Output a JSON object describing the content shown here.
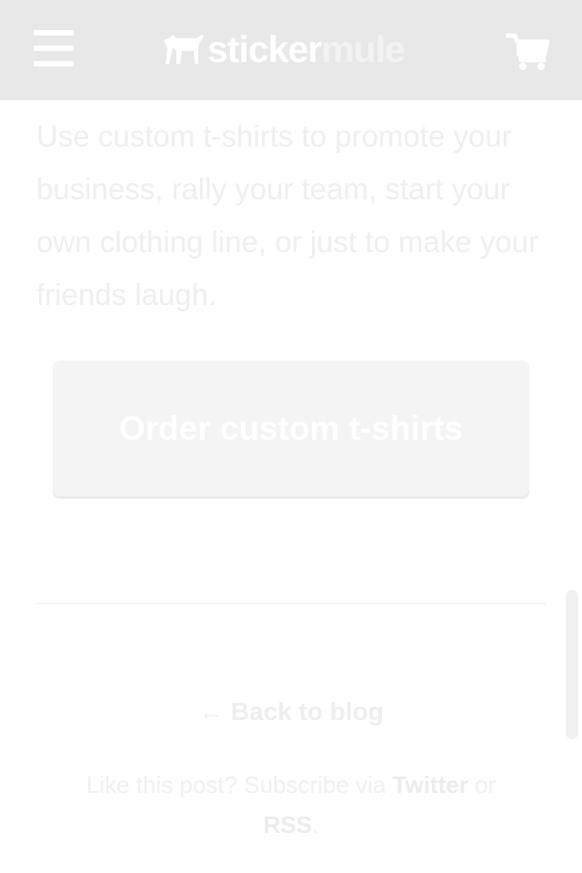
{
  "header": {
    "logo_part1": "sticker",
    "logo_part2": "mule",
    "menu_icon": "hamburger-menu-icon",
    "cart_icon": "shopping-cart-icon"
  },
  "content": {
    "intro_text": "Use custom t-shirts to promote your business, rally your team, start your own clothing line, or just to make your friends laugh.",
    "cta_label": "Order custom t-shirts"
  },
  "footer": {
    "back_link": "← Back to blog",
    "subscribe_prefix": "Like this post? Subscribe via",
    "twitter_label": "Twitter",
    "or_text": "or",
    "rss_label": "RSS",
    "period": "."
  },
  "colors": {
    "header_bg": "#e8e8e8",
    "faded_text": "#efefef",
    "button_bg": "#f4f4f4"
  }
}
